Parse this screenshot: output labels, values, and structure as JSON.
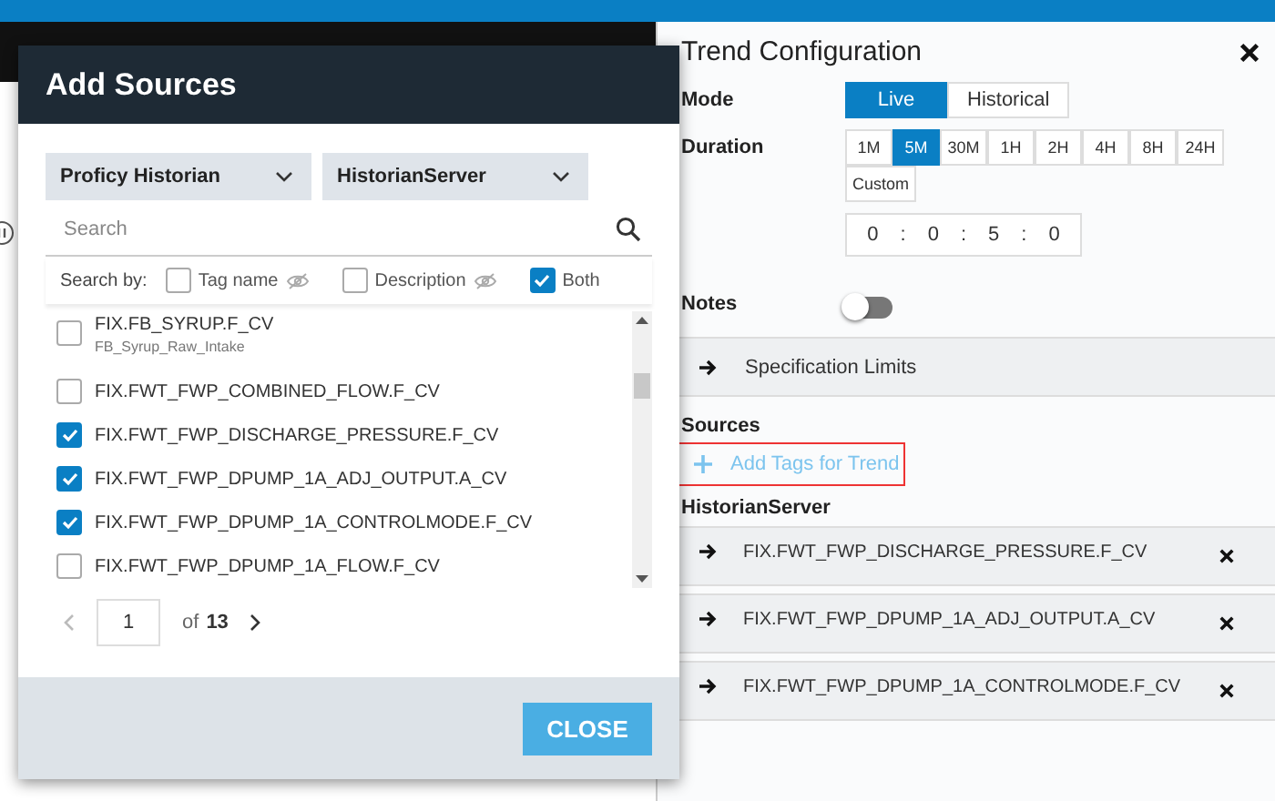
{
  "dialog": {
    "title": "Add Sources",
    "dropdowns": [
      {
        "value": "Proficy Historian"
      },
      {
        "value": "HistorianServer"
      }
    ],
    "search": {
      "placeholder": "Search"
    },
    "search_by": {
      "label": "Search by:",
      "options": [
        {
          "label": "Tag name",
          "checked": false,
          "visibility_icon": true
        },
        {
          "label": "Description",
          "checked": false,
          "visibility_icon": true
        },
        {
          "label": "Both",
          "checked": true,
          "visibility_icon": false
        }
      ]
    },
    "tags": [
      {
        "name": "FIX.FB_SYRUP.F_CV",
        "description": "FB_Syrup_Raw_Intake",
        "checked": false
      },
      {
        "name": "FIX.FWT_FWP_COMBINED_FLOW.F_CV",
        "checked": false
      },
      {
        "name": "FIX.FWT_FWP_DISCHARGE_PRESSURE.F_CV",
        "checked": true
      },
      {
        "name": "FIX.FWT_FWP_DPUMP_1A_ADJ_OUTPUT.A_CV",
        "checked": true
      },
      {
        "name": "FIX.FWT_FWP_DPUMP_1A_CONTROLMODE.F_CV",
        "checked": true
      },
      {
        "name": "FIX.FWT_FWP_DPUMP_1A_FLOW.F_CV",
        "checked": false
      }
    ],
    "pagination": {
      "page": "1",
      "of": "of",
      "total": "13"
    },
    "close_button": "CLOSE"
  },
  "panel": {
    "title": "Trend Configuration",
    "mode": {
      "label": "Mode",
      "options": [
        {
          "label": "Live",
          "selected": true
        },
        {
          "label": "Historical",
          "selected": false
        }
      ]
    },
    "duration": {
      "label": "Duration",
      "options": [
        {
          "label": "1M",
          "selected": false
        },
        {
          "label": "5M",
          "selected": true
        },
        {
          "label": "30M",
          "selected": false
        },
        {
          "label": "1H",
          "selected": false
        },
        {
          "label": "2H",
          "selected": false
        },
        {
          "label": "4H",
          "selected": false
        },
        {
          "label": "8H",
          "selected": false
        },
        {
          "label": "24H",
          "selected": false
        },
        {
          "label": "Custom",
          "selected": false
        }
      ],
      "time": {
        "parts": [
          "0",
          "0",
          "5",
          "0"
        ],
        "separator": ":"
      }
    },
    "notes": {
      "label": "Notes",
      "on": false
    },
    "specification_limits": "Specification Limits",
    "sources": {
      "label": "Sources",
      "add_link": {
        "label": "Add Tags for Trend",
        "highlighted": true
      },
      "server": "HistorianServer",
      "tags": [
        "FIX.FWT_FWP_DISCHARGE_PRESSURE.F_CV",
        "FIX.FWT_FWP_DPUMP_1A_ADJ_OUTPUT.A_CV",
        "FIX.FWT_FWP_DPUMP_1A_CONTROLMODE.F_CV"
      ]
    }
  }
}
